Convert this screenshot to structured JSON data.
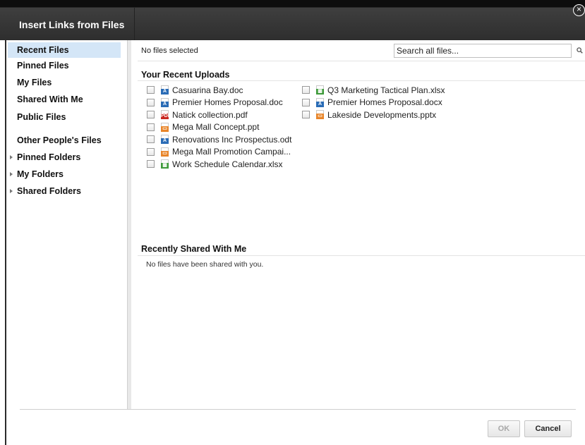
{
  "dialog": {
    "title": "Insert Links from Files",
    "close_glyph": "×"
  },
  "sidebar": {
    "items": [
      {
        "label": "Recent Files",
        "active": true,
        "expandable": false
      },
      {
        "label": "Pinned Files",
        "active": false,
        "expandable": false
      },
      {
        "label": "My Files",
        "active": false,
        "expandable": false
      },
      {
        "label": "Shared With Me",
        "active": false,
        "expandable": false
      },
      {
        "label": "Public Files",
        "active": false,
        "expandable": false
      },
      {
        "label": "Other People's Files",
        "active": false,
        "expandable": false
      },
      {
        "label": "Pinned Folders",
        "active": false,
        "expandable": true
      },
      {
        "label": "My Folders",
        "active": false,
        "expandable": true
      },
      {
        "label": "Shared Folders",
        "active": false,
        "expandable": true
      }
    ]
  },
  "main": {
    "status": "No files selected",
    "search": {
      "value": "Search all files...",
      "icon": "search-icon"
    },
    "recent_uploads": {
      "title": "Your Recent Uploads",
      "files": [
        {
          "name": "Casuarina Bay.doc",
          "type": "doc"
        },
        {
          "name": "Premier Homes Proposal.doc",
          "type": "doc"
        },
        {
          "name": "Natick collection.pdf",
          "type": "pdf"
        },
        {
          "name": "Mega Mall Concept.ppt",
          "type": "ppt"
        },
        {
          "name": "Renovations Inc Prospectus.odt",
          "type": "doc"
        },
        {
          "name": "Mega Mall Promotion Campai...",
          "type": "ppt"
        },
        {
          "name": "Work Schedule Calendar.xlsx",
          "type": "xls"
        },
        {
          "name": "Q3 Marketing Tactical Plan.xlsx",
          "type": "xls"
        },
        {
          "name": "Premier Homes Proposal.docx",
          "type": "doc"
        },
        {
          "name": "Lakeside Developments.pptx",
          "type": "ppt"
        }
      ]
    },
    "shared_with_me": {
      "title": "Recently Shared With Me",
      "empty_message": "No files have been shared with you."
    }
  },
  "footer": {
    "ok_label": "OK",
    "cancel_label": "Cancel",
    "ok_enabled": false
  },
  "colors": {
    "titlebar": "#2e2e2e",
    "active_nav": "#d4e6f7",
    "doc_icon": "#2a6cb6",
    "pdf_icon": "#c9261f",
    "ppt_icon": "#e8852a",
    "xls_icon": "#3e9a3a"
  }
}
